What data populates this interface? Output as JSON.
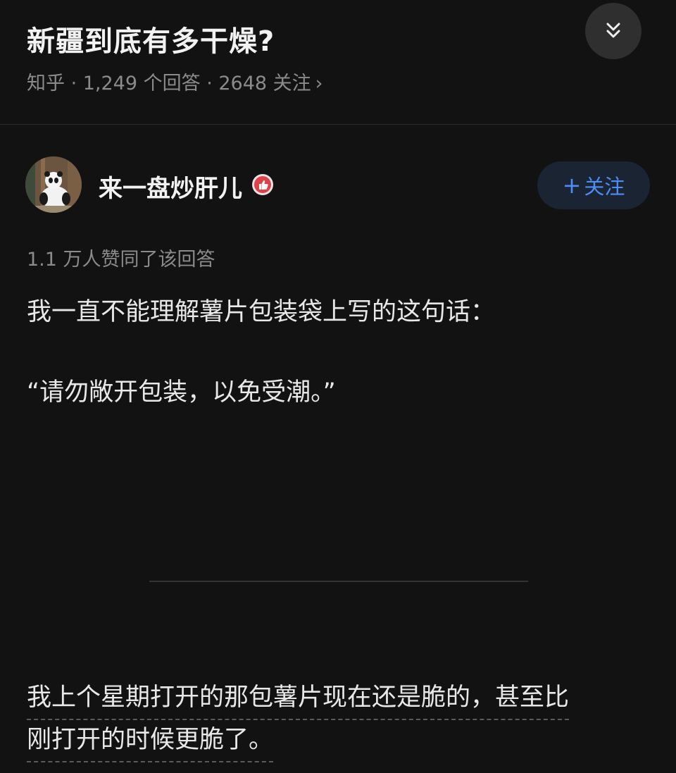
{
  "question": {
    "title": "新疆到底有多干燥?",
    "meta": "知乎 · 1,249 个回答 · 2648 关注",
    "meta_chevron": "›",
    "collapse_icon": "double-chevron-down-icon"
  },
  "author": {
    "name": "来一盘炒肝儿",
    "avatar_icon": "panda-avatar",
    "badge_icon": "thumbs-up-badge-icon",
    "follow_plus": "+",
    "follow_label": "关注"
  },
  "answer": {
    "votes": "1.1 万人赞同了该回答",
    "paragraph_1": "我一直不能理解薯片包装袋上写的这句话：",
    "paragraph_2": "“请勿敞开包装，以免受潮。”",
    "paragraph_3_line_1": "我上个星期打开的那包薯片现在还是脆的，甚至比",
    "paragraph_3_line_2": "刚打开的时候更脆了。"
  },
  "colors": {
    "background": "#121212",
    "accent": "#4c8df6",
    "follow_bg": "#1b2433",
    "muted_text": "#8b8b8b"
  }
}
